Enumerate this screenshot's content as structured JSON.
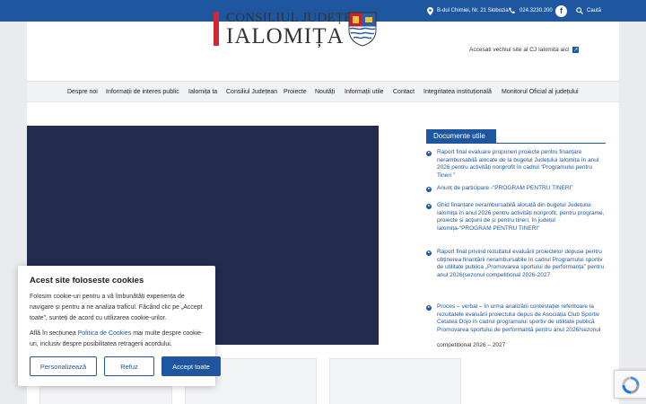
{
  "topbar": {
    "address": "B-dul Chimiei, Nr. 21 Slobozia",
    "phone": "024.3230.200",
    "facebook_glyph": "f",
    "search_label": "Caută",
    "background": "#1e56a0"
  },
  "header": {
    "logo_line1": "CONSILIUL JUDEȚEAN",
    "logo_line2": "IALOMIȚA",
    "old_site_text": "Accesati vechiul site al CJ Ialomita aici",
    "external_icon": "↗"
  },
  "nav": {
    "items": [
      "Despre noi",
      "Informații de interes public",
      "Ialomița ta",
      "Consiliul Județean",
      "Proiecte",
      "Noutăți",
      "Informații utile",
      "Contact",
      "Integritatea instituțională",
      "Monitorul Oficial al județului"
    ]
  },
  "sidebar": {
    "title": "Documente utile",
    "documents": [
      "Raport final evaluare propuneri proiecte pentru finanțare nerambursabilă alocate de la bugetul Județului Ialomița în anul 2026 pentru activități nonprofit în cadrul “Programului pentru Tineri ”",
      "Anunț de participare -“PROGRAM PENTRU TINERI”",
      "Ghid finanțare nerambursabilă alocată din bugetul Județului Ialomița în anul 2026 pentru activități nonprofit, pentru programe, proiecte și acțiuni de și pentru tineri, în județul Ialomița-“PROGRAM PENTRU TINERI”",
      "Raport final privind rezultatul evaluării proiectelor depuse pentru obținerea finanțării nerambursabile în cadrul Programului sportiv de utilitate publica „Promovarea sportului de performanța” pentru anul 2026(sezonul competițional 2026-2027",
      "Proces – verbal – în urma analizării contestației referitoare la rezultatele evaluării proiectului depus de Asociația Club Sportiv Cetatea Dojo  în cadrul programului sportiv de utilitate publică Promovarea sportului de performanță pentru anul 2026/sezonul"
    ],
    "last_line": "competițional 2026 – 2027"
  },
  "cookie": {
    "title": "Acest site foloseste cookies",
    "text": "Folosim cookie-uri pentru a vă îmbunătăți experiența de navigare și pentru a ne analiza traficul. Făcând clic pe „Accept toate”, sunteți de acord cu utilizarea cookie-urilor.",
    "text2_prefix": "Află în secțiunea",
    "text2_link": "Politica de Cookies",
    "text2_suffix": "mai multe despre cookie-uri, inclusiv despre posibilitatea retragerii acordului.",
    "buttons": {
      "customize": "Personalizează",
      "reject": "Refuz",
      "accept": "Accept toate"
    }
  },
  "colors": {
    "brand_blue": "#1e56a0",
    "slider_navy": "#232b4f",
    "logo_red": "#d1282f"
  }
}
